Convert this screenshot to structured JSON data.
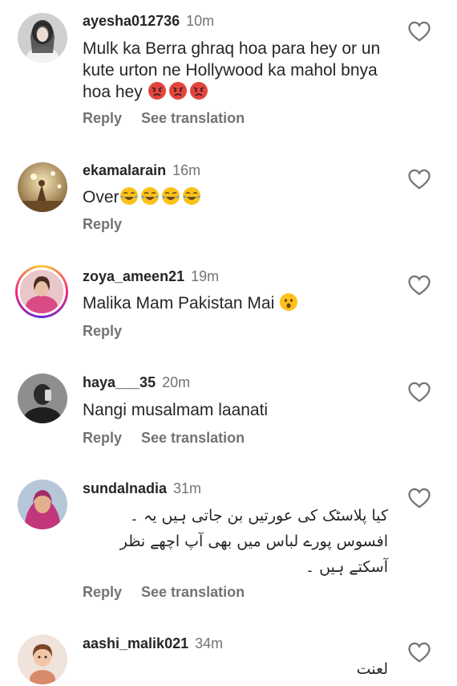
{
  "comments": [
    {
      "username": "ayesha012736",
      "time": "10m",
      "text": "Mulk ka Berra ghraq hoa para hey or un kute urton ne Hollywood ka mahol bnya hoa hey",
      "emojis": [
        "angry-face",
        "angry-face",
        "angry-face"
      ],
      "reply": "Reply",
      "translate": "See translation"
    },
    {
      "username": "ekamalarain",
      "time": "16m",
      "text": "Over",
      "emojis": [
        "tears-of-joy",
        "tears-of-joy",
        "tears-of-joy",
        "tears-of-joy"
      ],
      "reply": "Reply"
    },
    {
      "username": "zoya_ameen21",
      "time": "19m",
      "text": "Malika Mam Pakistan Mai",
      "emojis": [
        "hushed-face"
      ],
      "reply": "Reply"
    },
    {
      "username": "haya___35",
      "time": "20m",
      "text": "Nangi musalmam laanati",
      "reply": "Reply",
      "translate": "See translation"
    },
    {
      "username": "sundalnadia",
      "time": "31m",
      "text": "کیا پلاسٹک کی عورتیں بن جاتی ہیں یہ ۔ افسوس پورے لباس میں بھی آپ اچھے نظر آسکتے ہیں ۔",
      "reply": "Reply",
      "translate": "See translation"
    },
    {
      "username": "aashi_malik021",
      "time": "34m",
      "text": "لعنت"
    }
  ],
  "colors": {
    "text": "#262626",
    "secondary": "#737373",
    "emoji_yellow": "#fcc21b",
    "angry_red": "#e2453c"
  }
}
